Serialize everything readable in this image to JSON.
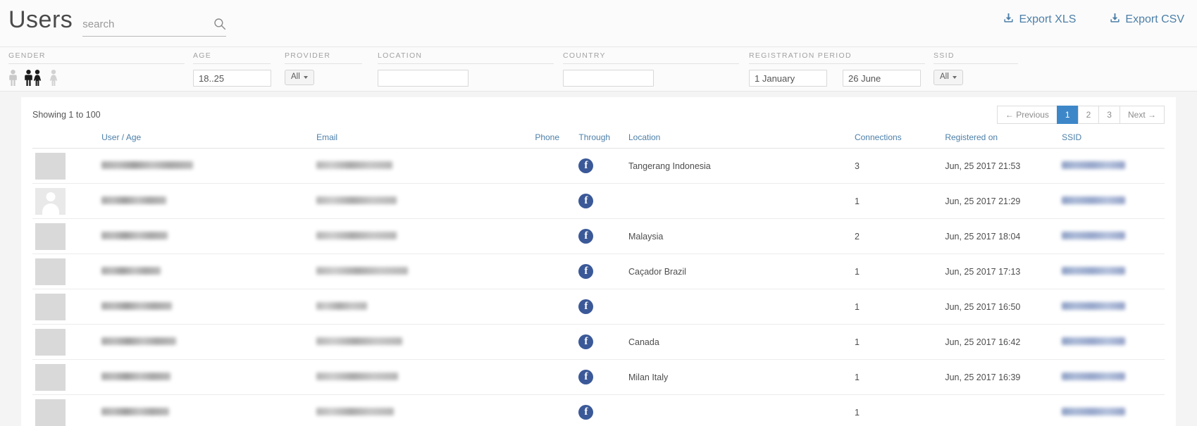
{
  "header": {
    "title": "Users",
    "search": {
      "value": "",
      "placeholder": "search"
    },
    "search_icon": "search-icon",
    "exports": [
      {
        "label": "Export XLS",
        "icon": "download-icon"
      },
      {
        "label": "Export CSV",
        "icon": "download-icon"
      }
    ]
  },
  "filters": {
    "gender": {
      "label": "GENDER",
      "options": [
        {
          "name": "male",
          "selected": false
        },
        {
          "name": "both",
          "selected": true
        },
        {
          "name": "female",
          "selected": false
        }
      ]
    },
    "age": {
      "label": "AGE",
      "value": "18..25",
      "placeholder": ""
    },
    "provider": {
      "label": "PROVIDER",
      "value": "All"
    },
    "location": {
      "label": "LOCATION",
      "value": "",
      "placeholder": ""
    },
    "country": {
      "label": "COUNTRY",
      "value": "",
      "placeholder": ""
    },
    "registration_period": {
      "label": "REGISTRATION PERIOD",
      "from": "1 January",
      "to": "26 June"
    },
    "ssid": {
      "label": "SSID",
      "value": "All"
    }
  },
  "table": {
    "showing": "Showing 1 to 100",
    "pagination": {
      "previous": "← Previous",
      "pages": [
        "1",
        "2",
        "3"
      ],
      "active_page": "1",
      "next": "Next →"
    },
    "columns": [
      "User / Age",
      "Email",
      "Phone",
      "Through",
      "Location",
      "Connections",
      "Registered on",
      "SSID"
    ],
    "rows": [
      {
        "avatar": "photo",
        "user": "redacted",
        "user_width": 130,
        "email": "redacted",
        "email_width": 108,
        "phone": "",
        "through": "facebook-icon",
        "location": "Tangerang Indonesia",
        "connections": "3",
        "registered_on": "Jun, 25 2017 21:53",
        "ssid": "redacted",
        "ssid_width": 90
      },
      {
        "avatar": "generic",
        "user": "redacted",
        "user_width": 92,
        "email": "redacted",
        "email_width": 114,
        "phone": "",
        "through": "facebook-icon",
        "location": "",
        "connections": "1",
        "registered_on": "Jun, 25 2017 21:29",
        "ssid": "redacted",
        "ssid_width": 90
      },
      {
        "avatar": "photo",
        "user": "redacted",
        "user_width": 94,
        "email": "redacted",
        "email_width": 114,
        "phone": "",
        "through": "facebook-icon",
        "location": "Malaysia",
        "connections": "2",
        "registered_on": "Jun, 25 2017 18:04",
        "ssid": "redacted",
        "ssid_width": 90
      },
      {
        "avatar": "photo",
        "user": "redacted",
        "user_width": 84,
        "email": "redacted",
        "email_width": 130,
        "phone": "",
        "through": "facebook-icon",
        "location": "Caçador Brazil",
        "connections": "1",
        "registered_on": "Jun, 25 2017 17:13",
        "ssid": "redacted",
        "ssid_width": 90
      },
      {
        "avatar": "photo",
        "user": "redacted",
        "user_width": 100,
        "email": "redacted",
        "email_width": 72,
        "phone": "",
        "through": "facebook-icon",
        "location": "",
        "connections": "1",
        "registered_on": "Jun, 25 2017 16:50",
        "ssid": "redacted",
        "ssid_width": 90
      },
      {
        "avatar": "photo",
        "user": "redacted",
        "user_width": 106,
        "email": "redacted",
        "email_width": 122,
        "phone": "",
        "through": "facebook-icon",
        "location": "Canada",
        "connections": "1",
        "registered_on": "Jun, 25 2017 16:42",
        "ssid": "redacted",
        "ssid_width": 90
      },
      {
        "avatar": "photo",
        "user": "redacted",
        "user_width": 98,
        "email": "redacted",
        "email_width": 116,
        "phone": "",
        "through": "facebook-icon",
        "location": "Milan Italy",
        "connections": "1",
        "registered_on": "Jun, 25 2017 16:39",
        "ssid": "redacted",
        "ssid_width": 90
      },
      {
        "avatar": "photo",
        "user": "redacted",
        "user_width": 96,
        "email": "redacted",
        "email_width": 110,
        "phone": "",
        "through": "facebook-icon",
        "location": "",
        "connections": "1",
        "registered_on": "",
        "ssid": "redacted",
        "ssid_width": 90
      }
    ]
  },
  "colors": {
    "accent": "#3d87c9",
    "link": "#4c7fa8",
    "facebook": "#3b5998"
  }
}
